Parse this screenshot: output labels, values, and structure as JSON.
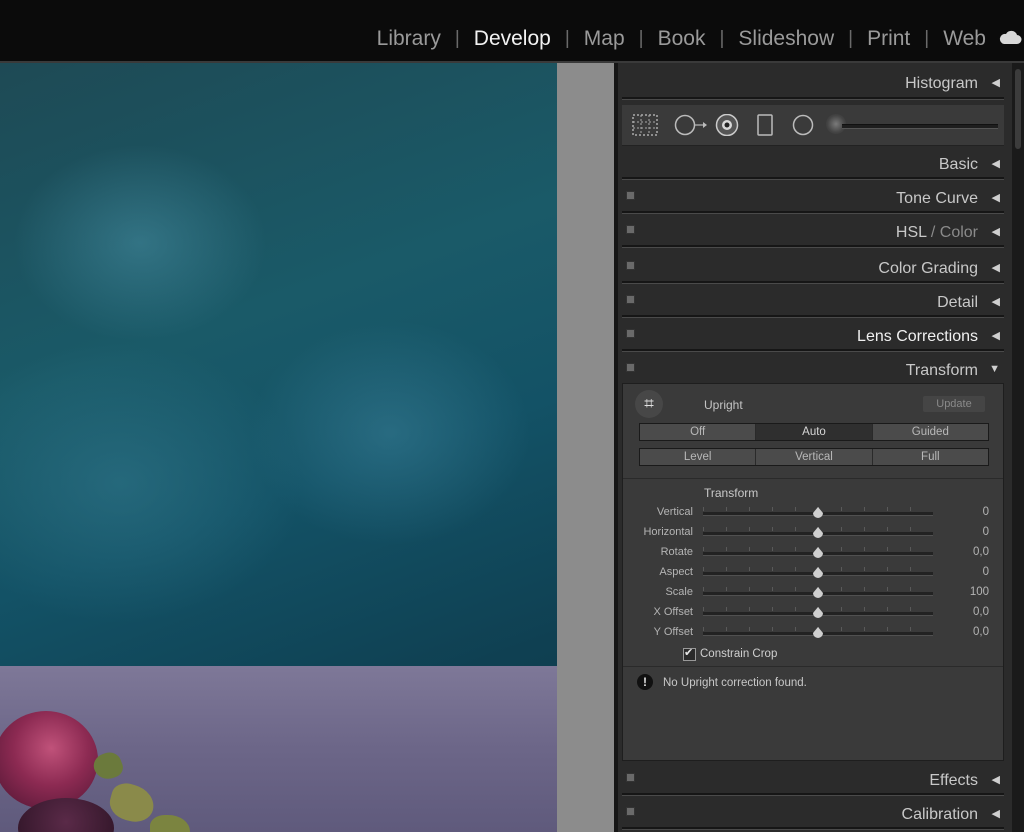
{
  "modules": {
    "items": [
      "Library",
      "Develop",
      "Map",
      "Book",
      "Slideshow",
      "Print",
      "Web"
    ],
    "active": "Develop",
    "cloud_icon": "cloud-icon"
  },
  "panel": {
    "histogram": "Histogram",
    "basic": "Basic",
    "tone_curve": "Tone Curve",
    "hsl": "HSL",
    "hsl_slash": " / ",
    "color": "Color",
    "color_grading": "Color Grading",
    "detail": "Detail",
    "lens_corrections": "Lens Corrections",
    "transform": "Transform",
    "effects": "Effects",
    "calibration": "Calibration"
  },
  "transform": {
    "upright_label": "Upright",
    "update_label": "Update",
    "row1": [
      "Off",
      "Auto",
      "Guided"
    ],
    "row1_selected": "Auto",
    "row2": [
      "Level",
      "Vertical",
      "Full"
    ],
    "section_title": "Transform",
    "sliders": [
      {
        "name": "Vertical",
        "value": "0"
      },
      {
        "name": "Horizontal",
        "value": "0"
      },
      {
        "name": "Rotate",
        "value": "0,0"
      },
      {
        "name": "Aspect",
        "value": "0"
      },
      {
        "name": "Scale",
        "value": "100"
      },
      {
        "name": "X Offset",
        "value": "0,0"
      },
      {
        "name": "Y Offset",
        "value": "0,0"
      }
    ],
    "constrain_crop": "Constrain Crop",
    "constrain_checked": true,
    "message": "No Upright correction found."
  }
}
